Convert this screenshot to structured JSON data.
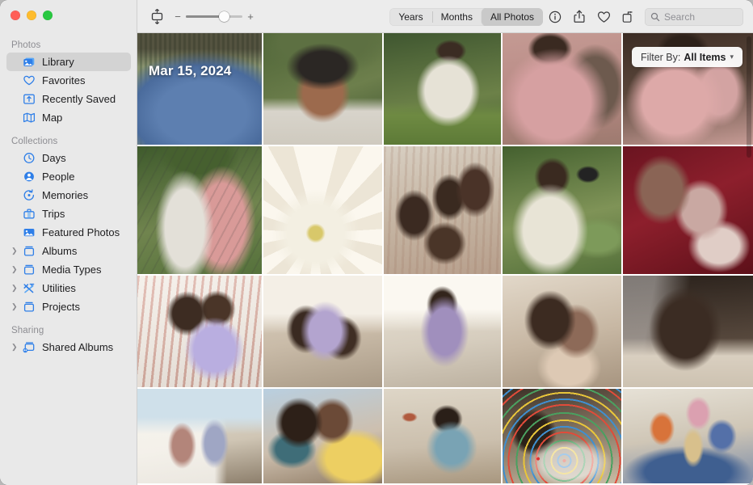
{
  "window": {
    "title": "Photos",
    "traffic_lights": [
      "close",
      "minimize",
      "zoom"
    ]
  },
  "sidebar": {
    "sections": [
      {
        "header": "Photos",
        "items": [
          {
            "label": "Library",
            "icon": "library-icon",
            "selected": true,
            "disclosure": false
          },
          {
            "label": "Favorites",
            "icon": "heart-icon",
            "selected": false,
            "disclosure": false
          },
          {
            "label": "Recently Saved",
            "icon": "recently-saved-icon",
            "selected": false,
            "disclosure": false
          },
          {
            "label": "Map",
            "icon": "map-icon",
            "selected": false,
            "disclosure": false
          }
        ]
      },
      {
        "header": "Collections",
        "items": [
          {
            "label": "Days",
            "icon": "clock-icon",
            "selected": false,
            "disclosure": false
          },
          {
            "label": "People",
            "icon": "person-icon",
            "selected": false,
            "disclosure": false
          },
          {
            "label": "Memories",
            "icon": "memories-icon",
            "selected": false,
            "disclosure": false
          },
          {
            "label": "Trips",
            "icon": "trips-icon",
            "selected": false,
            "disclosure": false
          },
          {
            "label": "Featured Photos",
            "icon": "featured-photos-icon",
            "selected": false,
            "disclosure": false
          },
          {
            "label": "Albums",
            "icon": "albums-icon",
            "selected": false,
            "disclosure": true
          },
          {
            "label": "Media Types",
            "icon": "media-types-icon",
            "selected": false,
            "disclosure": true
          },
          {
            "label": "Utilities",
            "icon": "utilities-icon",
            "selected": false,
            "disclosure": true
          },
          {
            "label": "Projects",
            "icon": "projects-icon",
            "selected": false,
            "disclosure": true
          }
        ]
      },
      {
        "header": "Sharing",
        "items": [
          {
            "label": "Shared Albums",
            "icon": "shared-albums-icon",
            "selected": false,
            "disclosure": true
          }
        ]
      }
    ]
  },
  "toolbar": {
    "view_options_icon": "view-options-icon",
    "zoom": {
      "minus": "−",
      "plus": "+",
      "value_percent": 72
    },
    "segmented_control": {
      "options": [
        "Years",
        "Months",
        "All Photos"
      ],
      "selected": "All Photos"
    },
    "actions": [
      {
        "label": "Info",
        "icon": "info-icon"
      },
      {
        "label": "Share",
        "icon": "share-icon"
      },
      {
        "label": "Favorite",
        "icon": "heart-icon"
      },
      {
        "label": "Rotate",
        "icon": "rotate-icon"
      }
    ],
    "search": {
      "placeholder": "Search",
      "value": "",
      "icon": "search-icon"
    }
  },
  "main": {
    "date_badge": "Mar 15, 2024",
    "filter": {
      "label": "Filter By:",
      "value": "All Items",
      "chevron": "∨"
    },
    "grid": {
      "columns": 5,
      "rows": 4,
      "photos": [
        {
          "alt": "person in blue cable-knit sweater against green striped wall",
          "row": 0,
          "col": 0
        },
        {
          "alt": "smiling person looking through binoculars in garden",
          "row": 0,
          "col": 1
        },
        {
          "alt": "child in cream sweater standing on lawn",
          "row": 0,
          "col": 2
        },
        {
          "alt": "two people in pink embracing outdoors",
          "row": 0,
          "col": 3
        },
        {
          "alt": "children in pink hugging by dark wall",
          "row": 0,
          "col": 4
        },
        {
          "alt": "two people hugging in plaid and pink hoodie among greenery",
          "row": 1,
          "col": 0
        },
        {
          "alt": "close-up of white dahlia flower held by person in pink",
          "row": 1,
          "col": 1
        },
        {
          "alt": "family group cuddling together on couch",
          "row": 1,
          "col": 2
        },
        {
          "alt": "boy with binoculars in front of flowering bushes",
          "row": 1,
          "col": 3
        },
        {
          "alt": "two children on red velvet sofa",
          "row": 1,
          "col": 4
        },
        {
          "alt": "family on striped bedding with child in lilac",
          "row": 2,
          "col": 0
        },
        {
          "alt": "family sitting on floor in sunlit living room",
          "row": 2,
          "col": 1
        },
        {
          "alt": "adult and child by bright window",
          "row": 2,
          "col": 2
        },
        {
          "alt": "two siblings leaning together indoors",
          "row": 2,
          "col": 3
        },
        {
          "alt": "person by window with curtain, back view",
          "row": 2,
          "col": 4
        },
        {
          "alt": "two children playing clapping game by window",
          "row": 3,
          "col": 0
        },
        {
          "alt": "child and older man with yellow blanket",
          "row": 3,
          "col": 1
        },
        {
          "alt": "child in striped top in a room with wall hooks",
          "row": 3,
          "col": 2
        },
        {
          "alt": "child lying on floor with colorful puzzle pieces",
          "row": 3,
          "col": 3
        },
        {
          "alt": "family playing block tower game on blue rug",
          "row": 3,
          "col": 4
        }
      ]
    },
    "scrollbar": {
      "visible": true
    }
  },
  "colors": {
    "accent_blue": "#0a84ff",
    "sidebar_bg": "#e9e9e9",
    "toolbar_bg": "#ececec",
    "selected_row": "#d3d3d3",
    "text_primary": "#1d1d1f",
    "text_secondary": "#8d8d92"
  }
}
